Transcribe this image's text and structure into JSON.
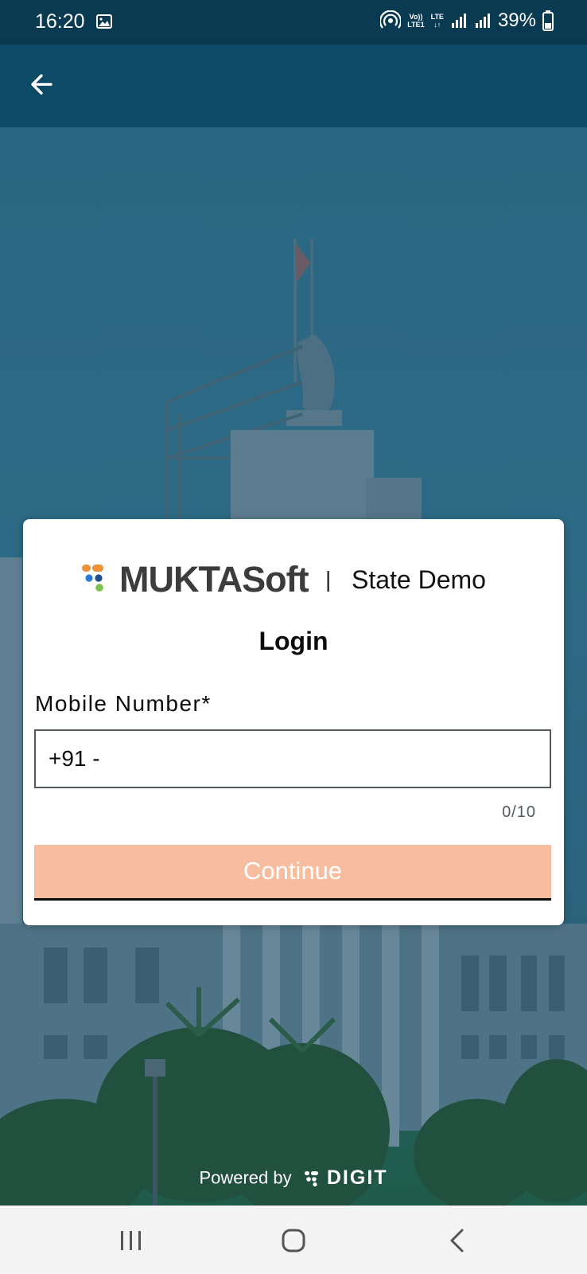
{
  "status_bar": {
    "time": "16:20",
    "volte_top": "Vo))",
    "volte_bottom": "LTE1",
    "network_label": "LTE",
    "battery_percent": "39%",
    "icons": [
      "gallery-icon",
      "hotspot-icon",
      "signal-icon",
      "battery-icon"
    ]
  },
  "app_bar": {
    "back_icon": "arrow-left-icon"
  },
  "brand": {
    "logo_text": "MUKTASoft",
    "separator": "|",
    "tenant_name": "State Demo",
    "dot_colors": [
      "#f0913a",
      "#2b7bd5",
      "#1f4f8a",
      "#7cc24a"
    ]
  },
  "login": {
    "title": "Login",
    "mobile_label": "Mobile Number*",
    "country_prefix": "+91 -",
    "mobile_value": "",
    "char_counter": "0/10",
    "continue_label": "Continue"
  },
  "footer": {
    "powered_by": "Powered by",
    "digit_text": "DIGIT"
  },
  "nav_bar": {
    "buttons": [
      "recent-apps-icon",
      "home-icon",
      "back-icon"
    ]
  },
  "colors": {
    "status_bar_bg": "#0a3a52",
    "app_bar_bg": "#0c4a66",
    "continue_bg": "#f8bd9f",
    "overlay_tint": "#2c6784"
  }
}
